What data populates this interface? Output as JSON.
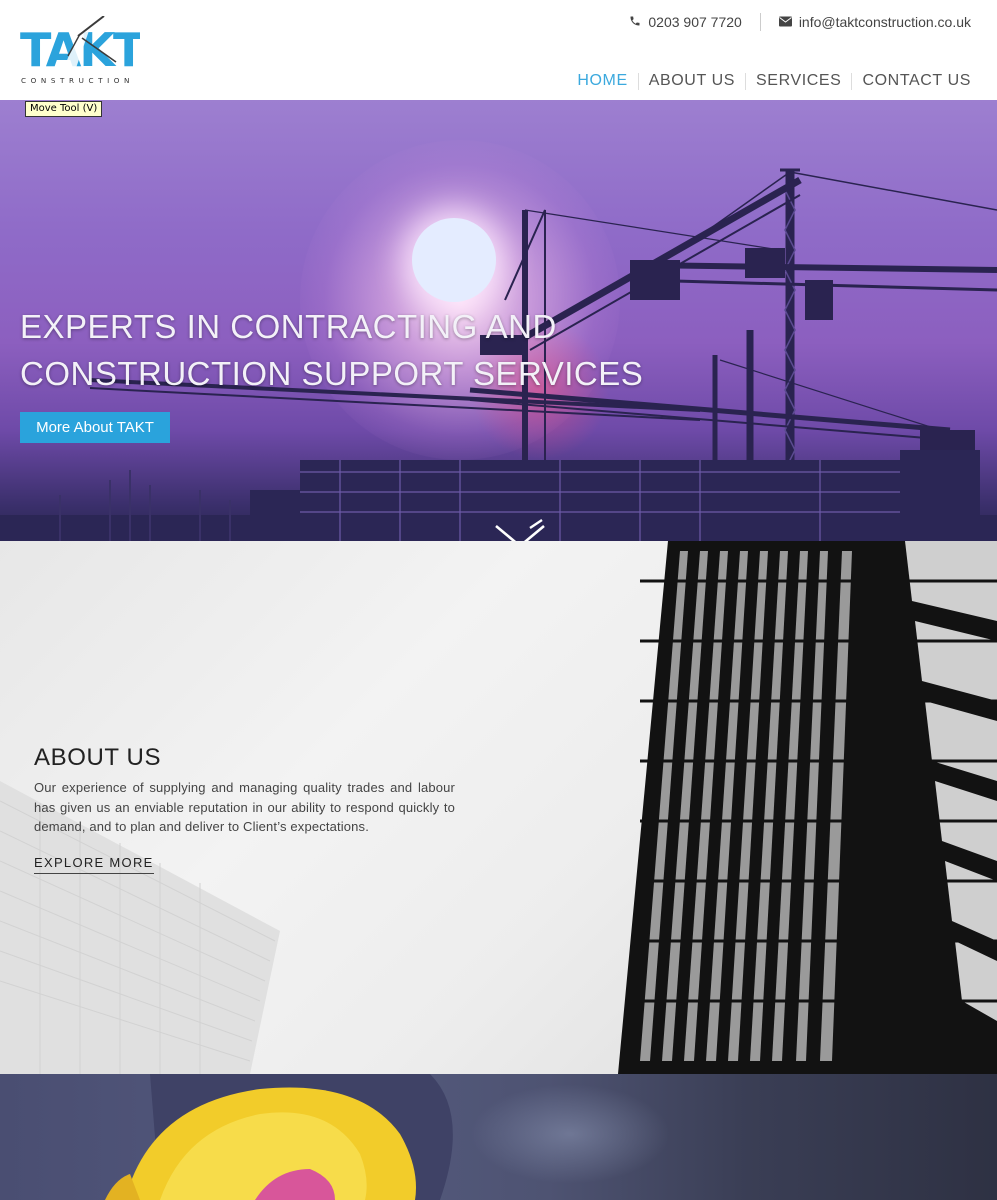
{
  "header": {
    "logo": {
      "word": "TAKT",
      "tagline": "CONSTRUCTION",
      "color": "#2ba3dc"
    },
    "contact": {
      "phone": "0203 907 7720",
      "email": "info@taktconstruction.co.uk",
      "phone_icon": "phone-icon",
      "email_icon": "envelope-icon"
    },
    "nav": [
      {
        "label": "HOME",
        "active": true
      },
      {
        "label": "ABOUT US",
        "active": false
      },
      {
        "label": "SERVICES",
        "active": false
      },
      {
        "label": "CONTACT US",
        "active": false
      }
    ]
  },
  "tooltip": "Move Tool (V)",
  "hero": {
    "title_line1": "EXPERTS IN CONTRACTING AND",
    "title_line2": "CONSTRUCTION SUPPORT SERVICES",
    "button_label": "More About TAKT",
    "scroll_icon": "chevron-down-icon"
  },
  "about": {
    "title": "ABOUT US",
    "text": "Our experience of supplying and managing quality trades and labour has given us an enviable reputation in our ability to respond quickly to demand, and to plan and deliver to Client’s expectations.",
    "link_label": "EXPLORE MORE"
  },
  "colors": {
    "accent": "#2ba3dc",
    "nav_active": "#3ba9de",
    "nav_text": "#555555"
  }
}
